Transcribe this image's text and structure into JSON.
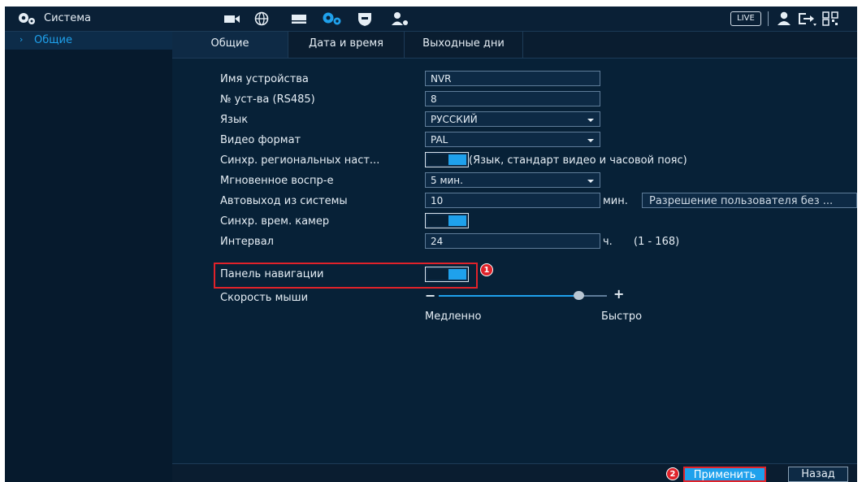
{
  "header": {
    "title": "Система",
    "live_label": "LIVE",
    "icons": [
      "camera-icon",
      "network-icon",
      "storage-icon",
      "system-icon",
      "security-icon",
      "account-icon",
      "user-icon",
      "logout-icon",
      "qr-icon"
    ]
  },
  "sidebar": {
    "items": [
      {
        "label": "Общие",
        "arrow": "›"
      }
    ]
  },
  "tabs": [
    {
      "label": "Общие",
      "active": true
    },
    {
      "label": "Дата и время",
      "active": false
    },
    {
      "label": "Выходные дни",
      "active": false
    }
  ],
  "form": {
    "device_name": {
      "label": "Имя устройства",
      "value": "NVR"
    },
    "device_no": {
      "label": "№ уст-ва (RS485)",
      "value": "8"
    },
    "language": {
      "label": "Язык",
      "value": "РУССКИЙ"
    },
    "video_format": {
      "label": "Видео формат",
      "value": "PAL"
    },
    "region_sync": {
      "label": "Синхр. региональных наст...",
      "note": "(Язык, стандарт видео и часовой пояс)",
      "enabled": true
    },
    "instant_playback": {
      "label": "Мгновенное воспр-е",
      "value": "5 мин."
    },
    "auto_logout": {
      "label": "Автовыход из системы",
      "value": "10",
      "unit": "мин.",
      "permission_button": "Разрешение пользователя без ..."
    },
    "camera_time_sync": {
      "label": "Синхр. врем. камер",
      "enabled": true
    },
    "interval": {
      "label": "Интервал",
      "value": "24",
      "unit": "ч.",
      "range": "(1 - 168)"
    },
    "nav_panel": {
      "label": "Панель навигации",
      "enabled": true,
      "badge": "1"
    },
    "mouse_speed": {
      "label": "Скорость мыши",
      "slow": "Медленно",
      "fast": "Быстро",
      "level": 0.78
    }
  },
  "footer": {
    "apply_label": "Применить",
    "apply_badge": "2",
    "back_label": "Назад"
  },
  "colors": {
    "accent": "#1fa1ec",
    "highlight": "#e0222a",
    "background": "#072137"
  }
}
